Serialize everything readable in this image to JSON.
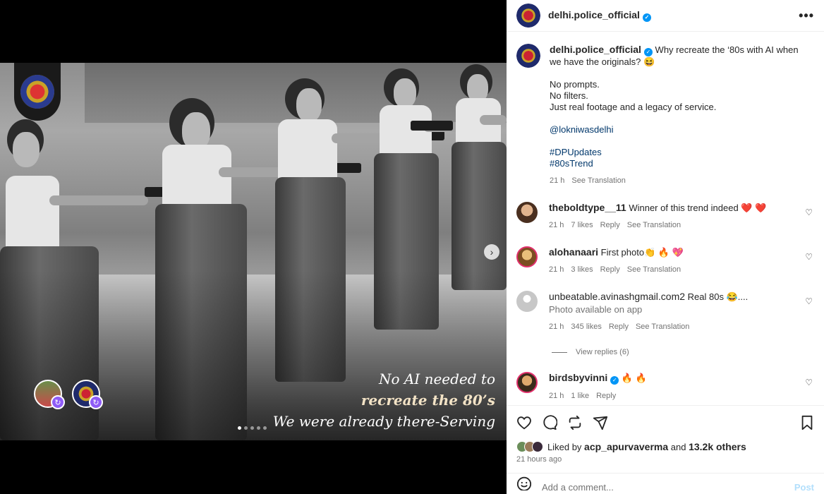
{
  "post": {
    "account": "delhi.police_official",
    "overlay": {
      "line1": "No AI needed to",
      "line2": "recreate the 80’s",
      "line3": "We were already there-Serving"
    },
    "carousel_total": 5,
    "carousel_current": 1
  },
  "caption": {
    "username": "delhi.police_official",
    "intro": "Why recreate the ‘80s with AI when we have the originals? 😆",
    "line1": "No prompts.",
    "line2": "No filters.",
    "line3": "Just real footage and a legacy of service.",
    "mention": "@lokniwasdelhi",
    "tag1": "#DPUpdates",
    "tag2": "#80sTrend",
    "time": "21 h",
    "see_translation": "See Translation"
  },
  "comments": [
    {
      "username": "theboldtype__11",
      "text": "Winner of this trend indeed ❤️ ❤️",
      "time": "21 h",
      "likes": "7 likes",
      "reply": "Reply",
      "translate": "See Translation",
      "avatar_color": "#8a6a4f"
    },
    {
      "username": "alohanaari",
      "text": "First photo👏 🔥 💖",
      "time": "21 h",
      "likes": "3 likes",
      "reply": "Reply",
      "translate": "See Translation",
      "avatar_color": "#d9a441"
    },
    {
      "username": "unbeatable.avinashgmail.com2",
      "text": "Real 80s 😂....",
      "sub": "Photo available on app",
      "time": "21 h",
      "likes": "345 likes",
      "reply": "Reply",
      "translate": "See Translation",
      "view_replies": "View replies (6)",
      "avatar_color": "#dbdbdb"
    },
    {
      "username": "birdsbyvinni",
      "text": "🔥 🔥",
      "time": "21 h",
      "likes": "1 like",
      "reply": "Reply",
      "avatar_color": "#c88a3a"
    }
  ],
  "actions": {
    "liked_by_prefix": "Liked by",
    "liked_by_user": "acp_apurvaverma",
    "liked_by_and": "and",
    "liked_by_others": "13.2k others",
    "time_ago": "21 hours ago"
  },
  "add_comment": {
    "placeholder": "Add a comment...",
    "post_label": "Post"
  },
  "colors": {
    "verified": "#0095f6",
    "link": "#00376b",
    "muted": "#737373",
    "collab_badge": "#8f5cf7"
  }
}
